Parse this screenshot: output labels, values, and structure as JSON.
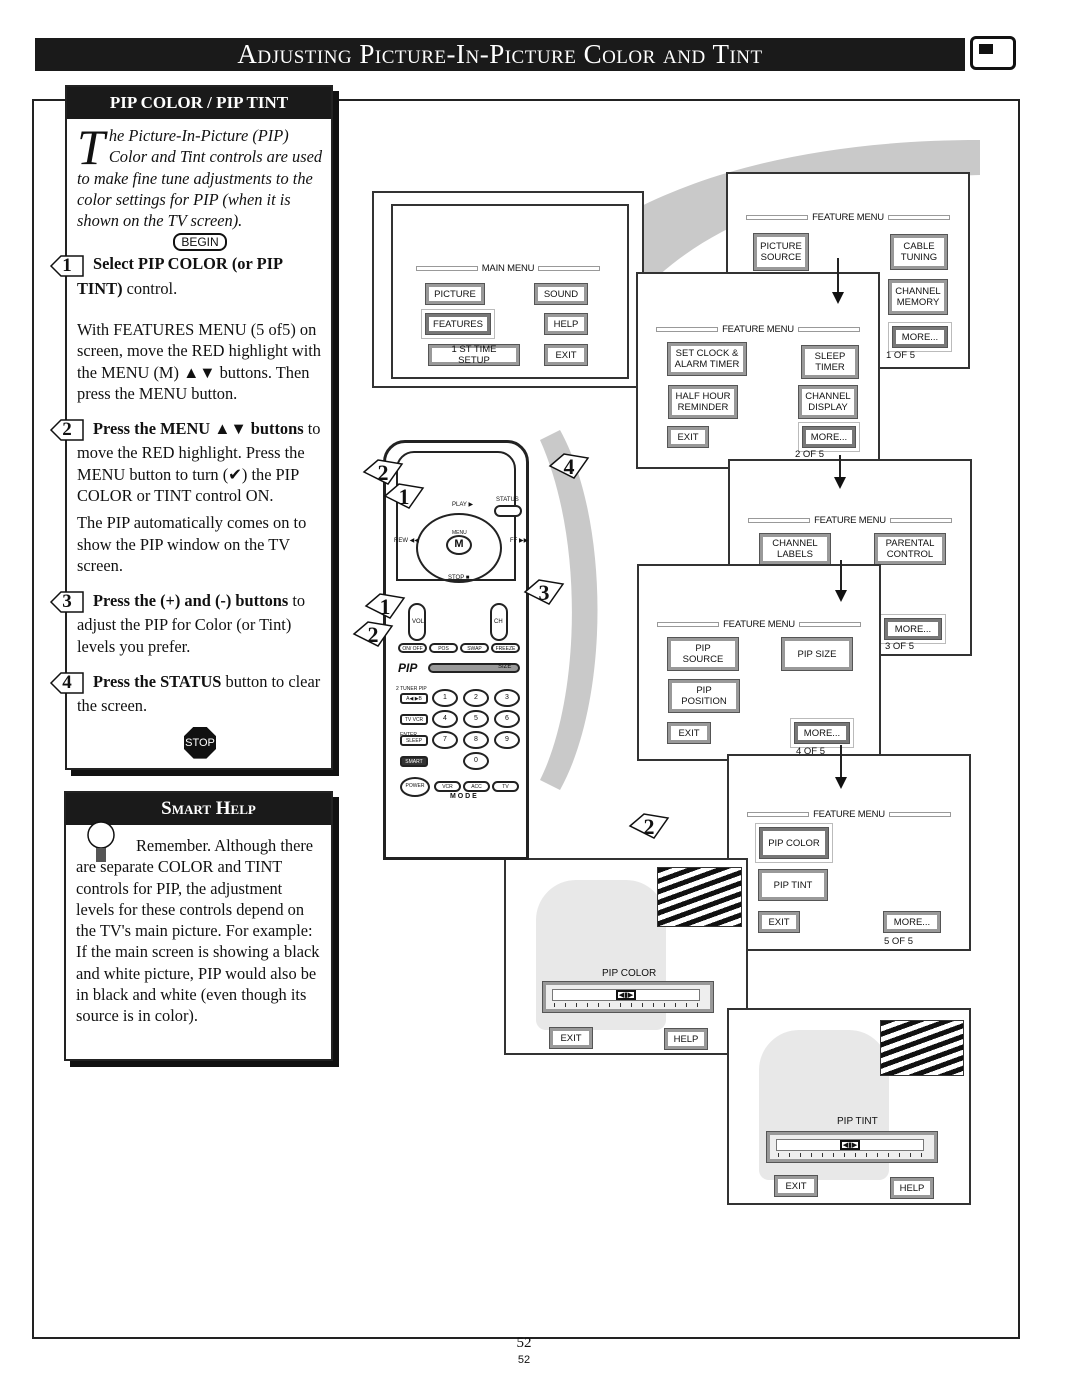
{
  "header": {
    "title": "Adjusting Picture-In-Picture Color and Tint",
    "icon": "tv-icon"
  },
  "instructions": {
    "heading": "PIP COLOR / PIP TINT",
    "intro_dropcap": "T",
    "intro": "he Picture-In-Picture (PIP) Color and Tint controls are used to make fine tune adjustments to the color settings for PIP (when it is shown on the TV screen).",
    "begin_badge": "BEGIN",
    "steps": [
      {
        "number": "1",
        "bold": "Select PIP COLOR (or PIP TINT)",
        "text": " control.",
        "extra": "With FEATURES MENU (5 of5) on screen, move the RED highlight with the MENU (M) ▲▼ buttons. Then press the MENU button."
      },
      {
        "number": "2",
        "bold": "Press the MENU ▲▼  buttons",
        "text": " to move the RED highlight. Press the MENU button to turn (✔) the PIP COLOR or TINT control ON.",
        "extra": "The PIP automatically comes on to show the PIP window on the TV screen."
      },
      {
        "number": "3",
        "bold": "Press the (+) and (-) buttons",
        "text": " to adjust the PIP for Color (or Tint) levels you prefer.",
        "extra": ""
      },
      {
        "number": "4",
        "bold": "Press the STATUS",
        "text": " button to clear the screen.",
        "extra": ""
      }
    ],
    "stop_badge": "STOP"
  },
  "smart_help": {
    "heading": "Smart Help",
    "icon": "lightbulb-icon",
    "text": "Remember. Although there are separate COLOR and TINT controls for PIP, the adjustment levels for these controls depend on the TV's main picture. For example: If the main screen is showing a black and white picture, PIP would also be in black and white (even though its source is in color)."
  },
  "main_menu": {
    "title": "MAIN MENU",
    "buttons": [
      "PICTURE",
      "SOUND",
      "FEATURES",
      "HELP",
      "1 ST TIME SETUP",
      "EXIT"
    ],
    "highlighted": "FEATURES"
  },
  "feature_menus": [
    {
      "title": "FEATURE MENU",
      "buttons": [
        "PICTURE SOURCE",
        "CABLE TUNING",
        "CHANNEL MEMORY",
        "MORE..."
      ],
      "page": "1 OF 5",
      "highlighted": "MORE..."
    },
    {
      "title": "FEATURE MENU",
      "buttons": [
        "SET CLOCK & ALARM TIMER",
        "SLEEP TIMER",
        "HALF HOUR REMINDER",
        "CHANNEL DISPLAY",
        "EXIT",
        "MORE..."
      ],
      "page": "2 OF 5",
      "highlighted": "MORE..."
    },
    {
      "title": "FEATURE MENU",
      "buttons": [
        "CHANNEL LABELS",
        "PARENTAL CONTROL",
        "MORE..."
      ],
      "page": "3 OF 5",
      "highlighted": "MORE..."
    },
    {
      "title": "FEATURE MENU",
      "buttons": [
        "PIP SOURCE",
        "PIP SIZE",
        "PIP POSITION",
        "EXIT",
        "MORE..."
      ],
      "page": "4 OF 5",
      "highlighted": "MORE..."
    },
    {
      "title": "FEATURE MENU",
      "buttons": [
        "PIP COLOR",
        "PIP TINT",
        "EXIT",
        "MORE..."
      ],
      "page": "5 OF 5",
      "highlighted": "PIP COLOR"
    }
  ],
  "pip_color_screen": {
    "label": "PIP COLOR",
    "level_percent": 50,
    "buttons": [
      "EXIT",
      "HELP"
    ]
  },
  "pip_tint_screen": {
    "label": "PIP TINT",
    "level_percent": 50,
    "buttons": [
      "EXIT",
      "HELP"
    ]
  },
  "remote": {
    "play": "PLAY ▶",
    "status": "STATUS",
    "menu": "M",
    "menu_small": "MENU",
    "rew": "REW ◀◀",
    "ff": "FF ▶▶",
    "stop": "STOP ■",
    "vol": "VOL",
    "ch": "CH",
    "pip_row": [
      "ON/ OFF",
      "POS",
      "SWAP",
      "FREEZE"
    ],
    "pip_logo": "PIP",
    "size": "SIZE",
    "tuner_pip": "2 TUNER PIP",
    "left_buttons": [
      "A◀ ▶B",
      "TV VCR",
      "SLEEP",
      "SMART"
    ],
    "enter": "ENTER",
    "digits": [
      "1",
      "2",
      "3",
      "4",
      "5",
      "6",
      "7",
      "8",
      "9",
      "0"
    ],
    "power": "POWER",
    "modes": [
      "VCR",
      "ACC",
      "TV"
    ],
    "mode_label": "M   O   D   E"
  },
  "step_tags": [
    "2",
    "1",
    "4",
    "3",
    "1",
    "2",
    "2"
  ],
  "page_number": "52"
}
